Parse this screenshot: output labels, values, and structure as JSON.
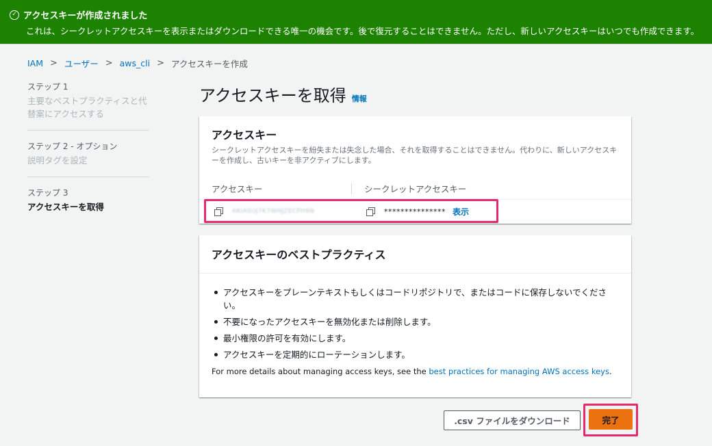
{
  "banner": {
    "title": "アクセスキーが作成されました",
    "message": "これは、シークレットアクセスキーを表示またはダウンロードできる唯一の機会です。後で復元することはできません。ただし、新しいアクセスキーはいつでも作成できます。",
    "icon": "check-circle-icon",
    "color": "#1d8102"
  },
  "breadcrumb": {
    "items": [
      "IAM",
      "ユーザー",
      "aws_cli"
    ],
    "current": "アクセスキーを作成",
    "separator": ">"
  },
  "steps": [
    {
      "number": "ステップ 1",
      "title": "主要なベストプラクティスと代替案にアクセスする"
    },
    {
      "number": "ステップ 2 - オプション",
      "title": "説明タグを設定"
    },
    {
      "number": "ステップ 3",
      "title": "アクセスキーを取得"
    }
  ],
  "page": {
    "title": "アクセスキーを取得",
    "info_link": "情報"
  },
  "access_keys": {
    "title": "アクセスキー",
    "description": "シークレットアクセスキーを紛失または失念した場合、それを取得することはできません。代わりに、新しいアクセスキーを作成し、古いキーを非アクティブにします。",
    "columns": [
      "アクセスキー",
      "シークレットアクセスキー"
    ],
    "access_key_value": "AKIASUJ7K7WHJZECPH6N",
    "secret_masked": "***************",
    "show_label": "表示"
  },
  "best_practices": {
    "title": "アクセスキーのベストプラクティス",
    "items": [
      "アクセスキーをプレーンテキストもしくはコードリポジトリで、またはコードに保存しないでください。",
      "不要になったアクセスキーを無効化または削除します。",
      "最小権限の許可を有効にします。",
      "アクセスキーを定期的にローテーションします。"
    ],
    "more_prefix": "For more details about managing access keys, see the ",
    "more_link": "best practices for managing AWS access keys",
    "more_suffix": "."
  },
  "footer": {
    "download_label": ".csv ファイルをダウンロード",
    "done_label": "完了"
  },
  "colors": {
    "accent": "#0073bb",
    "primary_button": "#ec7211",
    "highlight": "#e8286e"
  }
}
